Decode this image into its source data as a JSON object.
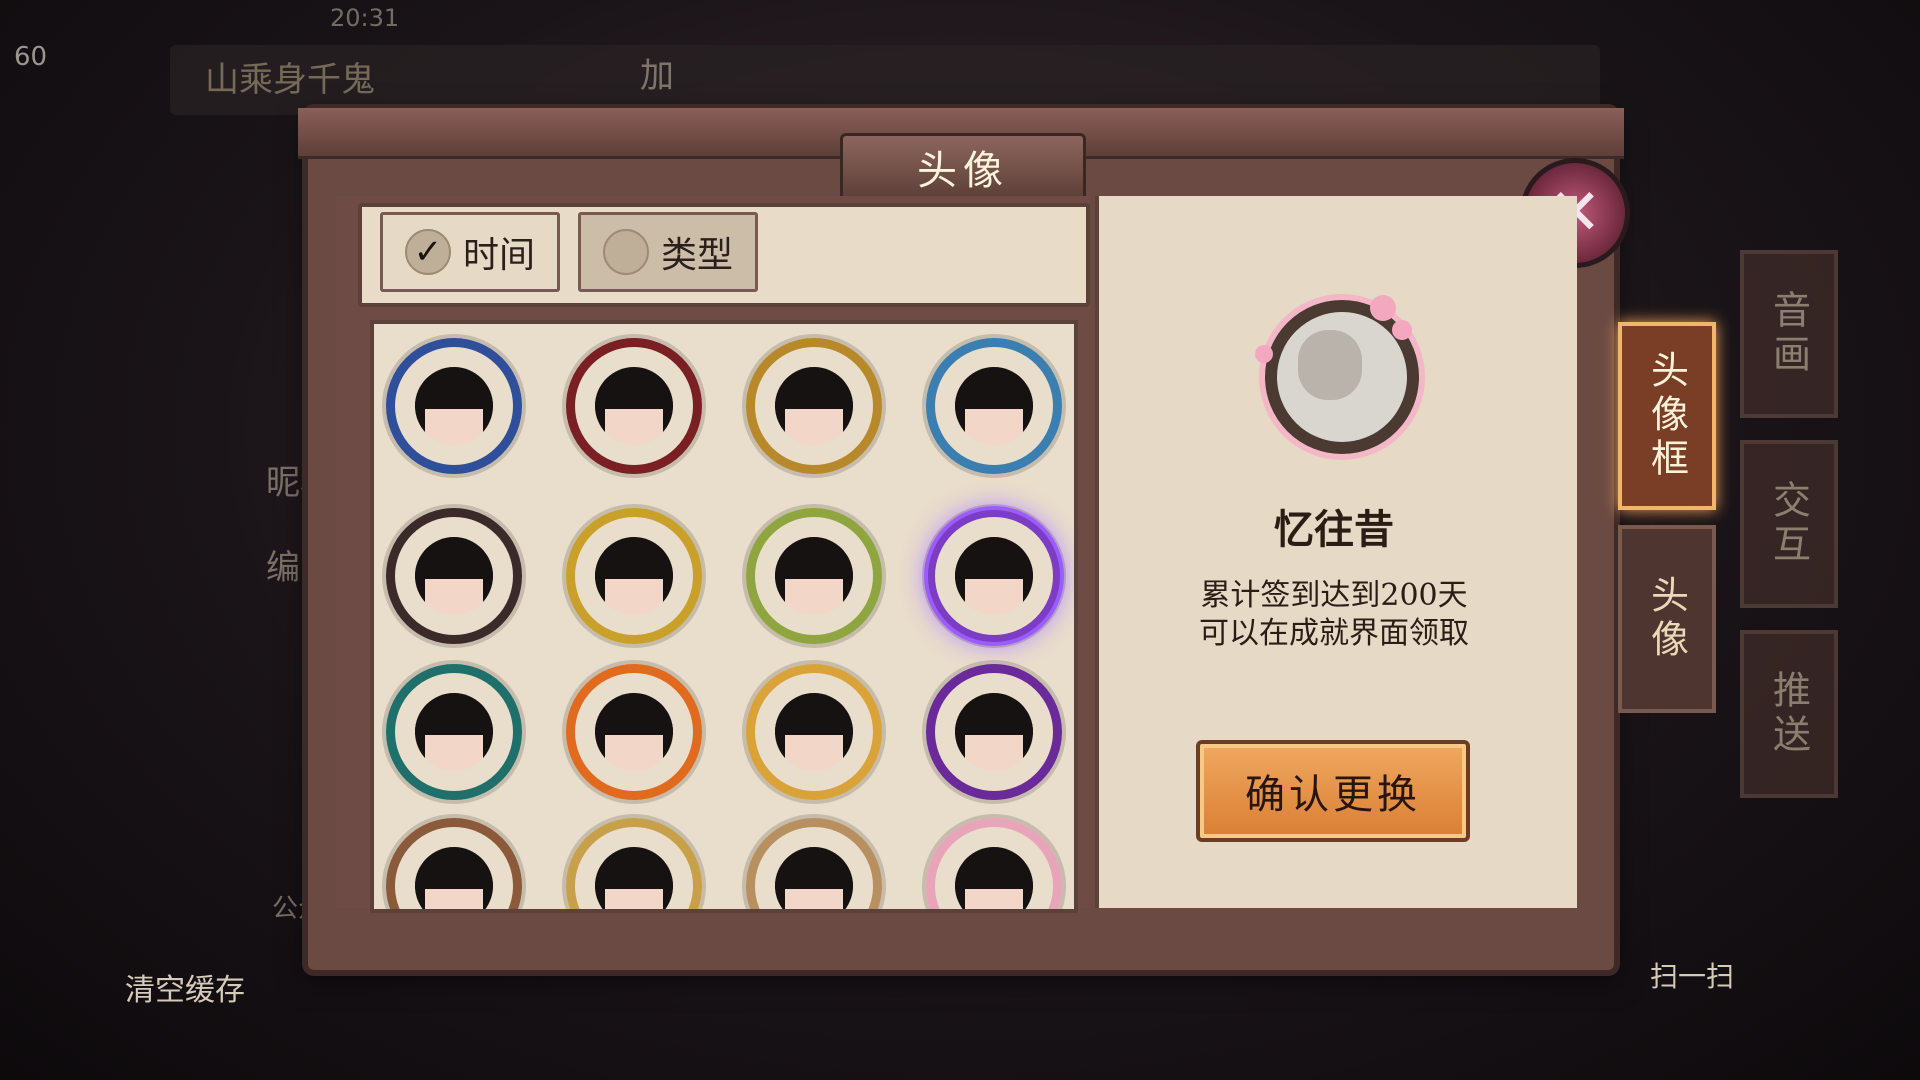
{
  "status": {
    "time": "20:31",
    "level": "60"
  },
  "player": {
    "name": "山乘身千鬼",
    "add_label": "加"
  },
  "background": {
    "nickname_label": "昵称",
    "id_label": "编号",
    "public_label": "公众",
    "clear_cache_label": "清空缓存",
    "scan_label": "扫一扫"
  },
  "panel": {
    "title": "头像"
  },
  "sort_tabs": [
    {
      "label": "时间",
      "selected": true
    },
    {
      "label": "类型",
      "selected": false
    }
  ],
  "avatar_frames": [
    {
      "name": "frame-1",
      "color": "#2f4f9a"
    },
    {
      "name": "frame-2",
      "color": "#7a1f24"
    },
    {
      "name": "frame-3",
      "color": "#b8892a"
    },
    {
      "name": "frame-4",
      "color": "#3a7fb0"
    },
    {
      "name": "frame-5",
      "color": "#3b2a2a"
    },
    {
      "name": "frame-6",
      "color": "#c8a02a"
    },
    {
      "name": "frame-7",
      "color": "#8fa640"
    },
    {
      "name": "frame-8",
      "color": "#7c3cc4",
      "selected": true
    },
    {
      "name": "frame-9",
      "color": "#1f6f6a"
    },
    {
      "name": "frame-10",
      "color": "#e06a1e"
    },
    {
      "name": "frame-11",
      "color": "#d9a33a"
    },
    {
      "name": "frame-12",
      "color": "#6a2a9a"
    },
    {
      "name": "frame-13",
      "color": "#8a5a3a"
    },
    {
      "name": "frame-14",
      "color": "#c9a04a"
    },
    {
      "name": "frame-15",
      "color": "#b89060"
    },
    {
      "name": "frame-16",
      "color": "#e8a4b8"
    }
  ],
  "detail": {
    "name": "忆往昔",
    "desc_line1": "累计签到达到200天",
    "desc_line2": "可以在成就界面领取",
    "confirm_label": "确认更换"
  },
  "side_tabs": [
    {
      "label": "头像框",
      "active": true
    },
    {
      "label": "头像",
      "active": false
    }
  ],
  "settings_tabs": [
    {
      "label": "音画"
    },
    {
      "label": "交互"
    },
    {
      "label": "推送"
    }
  ]
}
